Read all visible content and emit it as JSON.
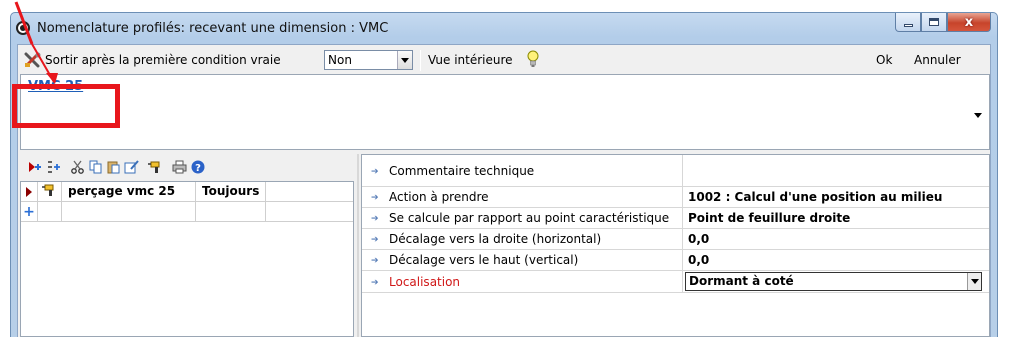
{
  "window": {
    "title": "Nomenclature profilés: recevant une dimension : VMC",
    "controls": {
      "minimize": "minimize",
      "maximize": "maximize",
      "close": "x"
    }
  },
  "toolbar": {
    "exit_label": "Sortir après la première condition vraie",
    "exit_value": "Non",
    "interior_view_label": "Vue intérieure",
    "ok_label": "Ok",
    "cancel_label": "Annuler"
  },
  "dimension": {
    "link_label": "VMC 25"
  },
  "operations": {
    "rows": [
      {
        "name": "perçage vmc 25",
        "condition": "Toujours"
      }
    ]
  },
  "properties": [
    {
      "key": "Commentaire technique",
      "value": ""
    },
    {
      "key": "Action à prendre",
      "value": "1002 : Calcul d'une position au milieu"
    },
    {
      "key": "Se calcule par rapport au point caractéristique",
      "value": "Point de feuillure droite"
    },
    {
      "key": "Décalage vers la droite (horizontal)",
      "value": "0,0"
    },
    {
      "key": "Décalage vers le haut (vertical)",
      "value": "0,0"
    },
    {
      "key": "Localisation",
      "value": "Dormant à coté"
    }
  ],
  "colors": {
    "annotation": "#e8161c",
    "link": "#1f5fb8",
    "highlight_key": "#d01818"
  },
  "icons": {
    "app": "app-icon",
    "tools": "tools-icon",
    "bulb": "bulb-icon",
    "combo": "chevron-down-icon",
    "row_marker": "row-pointer-icon",
    "new_row": "plus-icon",
    "property": "arrow-right-icon"
  }
}
